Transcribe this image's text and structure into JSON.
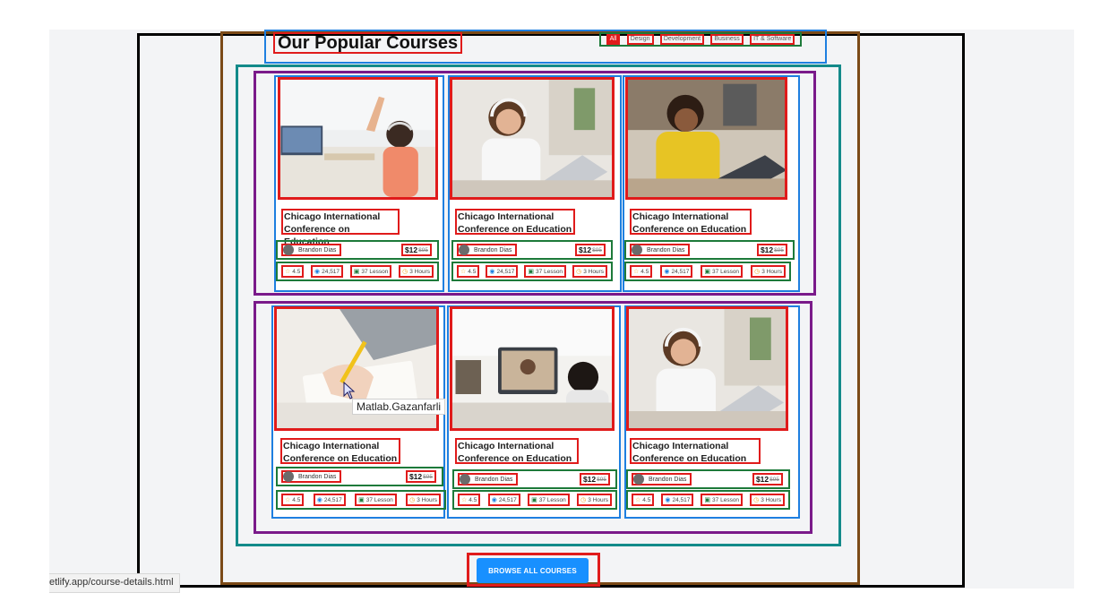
{
  "section": {
    "title": "Our Popular Courses",
    "filters": [
      "All",
      "Design",
      "Development",
      "Business",
      "IT & Software"
    ]
  },
  "courses": [
    {
      "title": "Chicago International Conference on Education",
      "author": "Brandon Dias",
      "price": "$12",
      "old_price": "$95",
      "rating": "4.5",
      "students": "24,517",
      "lessons": "37 Lesson",
      "duration": "3 Hours",
      "image": "girl-raising-hand-laptop"
    },
    {
      "title": "Chicago International Conference on Education",
      "author": "Brandon Dias",
      "price": "$12",
      "old_price": "$95",
      "rating": "4.5",
      "students": "24,517",
      "lessons": "37 Lesson",
      "duration": "3 Hours",
      "image": "woman-headphones-laptop"
    },
    {
      "title": "Chicago International Conference on Education",
      "author": "Brandon Dias",
      "price": "$12",
      "old_price": "$95",
      "rating": "4.5",
      "students": "24,517",
      "lessons": "37 Lesson",
      "duration": "3 Hours",
      "image": "man-yellow-shirt-laptop"
    },
    {
      "title": "Chicago International Conference on Education",
      "author": "Brandon Dias",
      "price": "$12",
      "old_price": "$95",
      "rating": "4.5",
      "students": "24,517",
      "lessons": "37 Lesson",
      "duration": "3 Hours",
      "image": "hand-writing-notebook"
    },
    {
      "title": "Chicago International Conference on Education",
      "author": "Brandon Dias",
      "price": "$12",
      "old_price": "$95",
      "rating": "4.5",
      "students": "24,517",
      "lessons": "37 Lesson",
      "duration": "3 Hours",
      "image": "child-video-call"
    },
    {
      "title": "Chicago International Conference on Education",
      "author": "Brandon Dias",
      "price": "$12",
      "old_price": "$95",
      "rating": "4.5",
      "students": "24,517",
      "lessons": "37 Lesson",
      "duration": "3 Hours",
      "image": "woman-headphones-laptop"
    }
  ],
  "browse_button": "BROWSE ALL COURSES",
  "status_url": "etlify.app/course-details.html",
  "tooltip": "Matlab.Gazanfarli",
  "colors": {
    "primary": "#1890ff",
    "outline_red": "#e01b1b",
    "outline_blue": "#1e7fe0",
    "outline_green": "#1d7a3a",
    "outline_purple": "#7a1a8a",
    "outline_teal": "#138a8a",
    "background": "#f3f4f6"
  }
}
